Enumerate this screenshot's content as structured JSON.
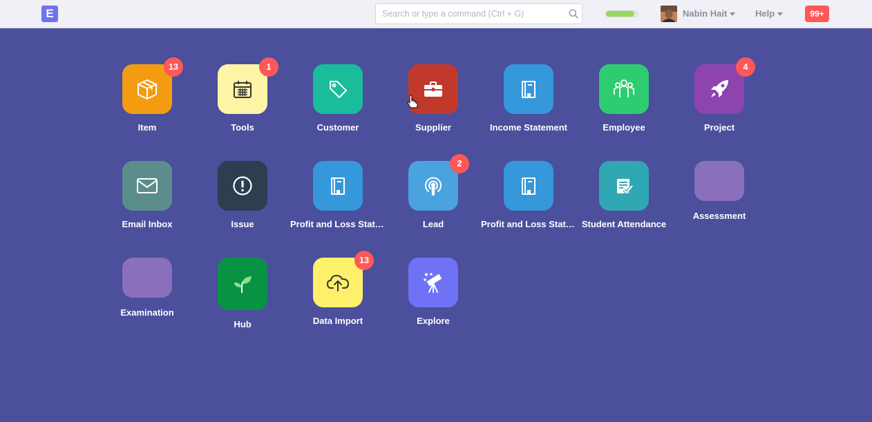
{
  "navbar": {
    "brand_letter": "E",
    "search_placeholder": "Search or type a command (Ctrl + G)",
    "progress_fraction": 0.9,
    "user_name": "Nabin Hait",
    "help_label": "Help",
    "notifications": "99+"
  },
  "modules": [
    {
      "label": "Item",
      "badge": "13",
      "color": "#f39c12",
      "icon": "box-icon"
    },
    {
      "label": "Tools",
      "badge": "1",
      "color": "#fef4a5",
      "icon": "calendar-icon"
    },
    {
      "label": "Customer",
      "badge": "",
      "color": "#1abc9c",
      "icon": "tag-icon"
    },
    {
      "label": "Supplier",
      "badge": "",
      "color": "#c0392b",
      "icon": "briefcase-icon"
    },
    {
      "label": "Income Statement",
      "badge": "",
      "color": "#3498db",
      "icon": "book-icon"
    },
    {
      "label": "Employee",
      "badge": "",
      "color": "#2ecc71",
      "icon": "people-icon"
    },
    {
      "label": "Project",
      "badge": "4",
      "color": "#8e44ad",
      "icon": "rocket-icon"
    },
    {
      "label": "Email Inbox",
      "badge": "",
      "color": "#5b8e8a",
      "icon": "envelope-icon"
    },
    {
      "label": "Issue",
      "badge": "",
      "color": "#2c3e50",
      "icon": "exclamation-icon"
    },
    {
      "label": "Profit and Loss Statement",
      "badge": "",
      "color": "#3498db",
      "icon": "book-icon"
    },
    {
      "label": "Lead",
      "badge": "2",
      "color": "#4aa3df",
      "icon": "podcast-icon"
    },
    {
      "label": "Profit and Loss Statement",
      "badge": "",
      "color": "#3498db",
      "icon": "book-icon"
    },
    {
      "label": "Student Attendance",
      "badge": "",
      "color": "#30a8b3",
      "icon": "checklist-icon"
    },
    {
      "label": "Assessment",
      "badge": "",
      "color": "#8a6fbc",
      "icon": "blank-icon"
    },
    {
      "label": "Examination",
      "badge": "",
      "color": "#8a6fbc",
      "icon": "blank-icon"
    },
    {
      "label": "Hub",
      "badge": "",
      "color": "#089344",
      "icon": "sprout-icon"
    },
    {
      "label": "Data Import",
      "badge": "13",
      "color": "#fef06a",
      "icon": "cloud-upload-icon"
    },
    {
      "label": "Explore",
      "badge": "",
      "color": "#7072f5",
      "icon": "telescope-icon"
    }
  ]
}
